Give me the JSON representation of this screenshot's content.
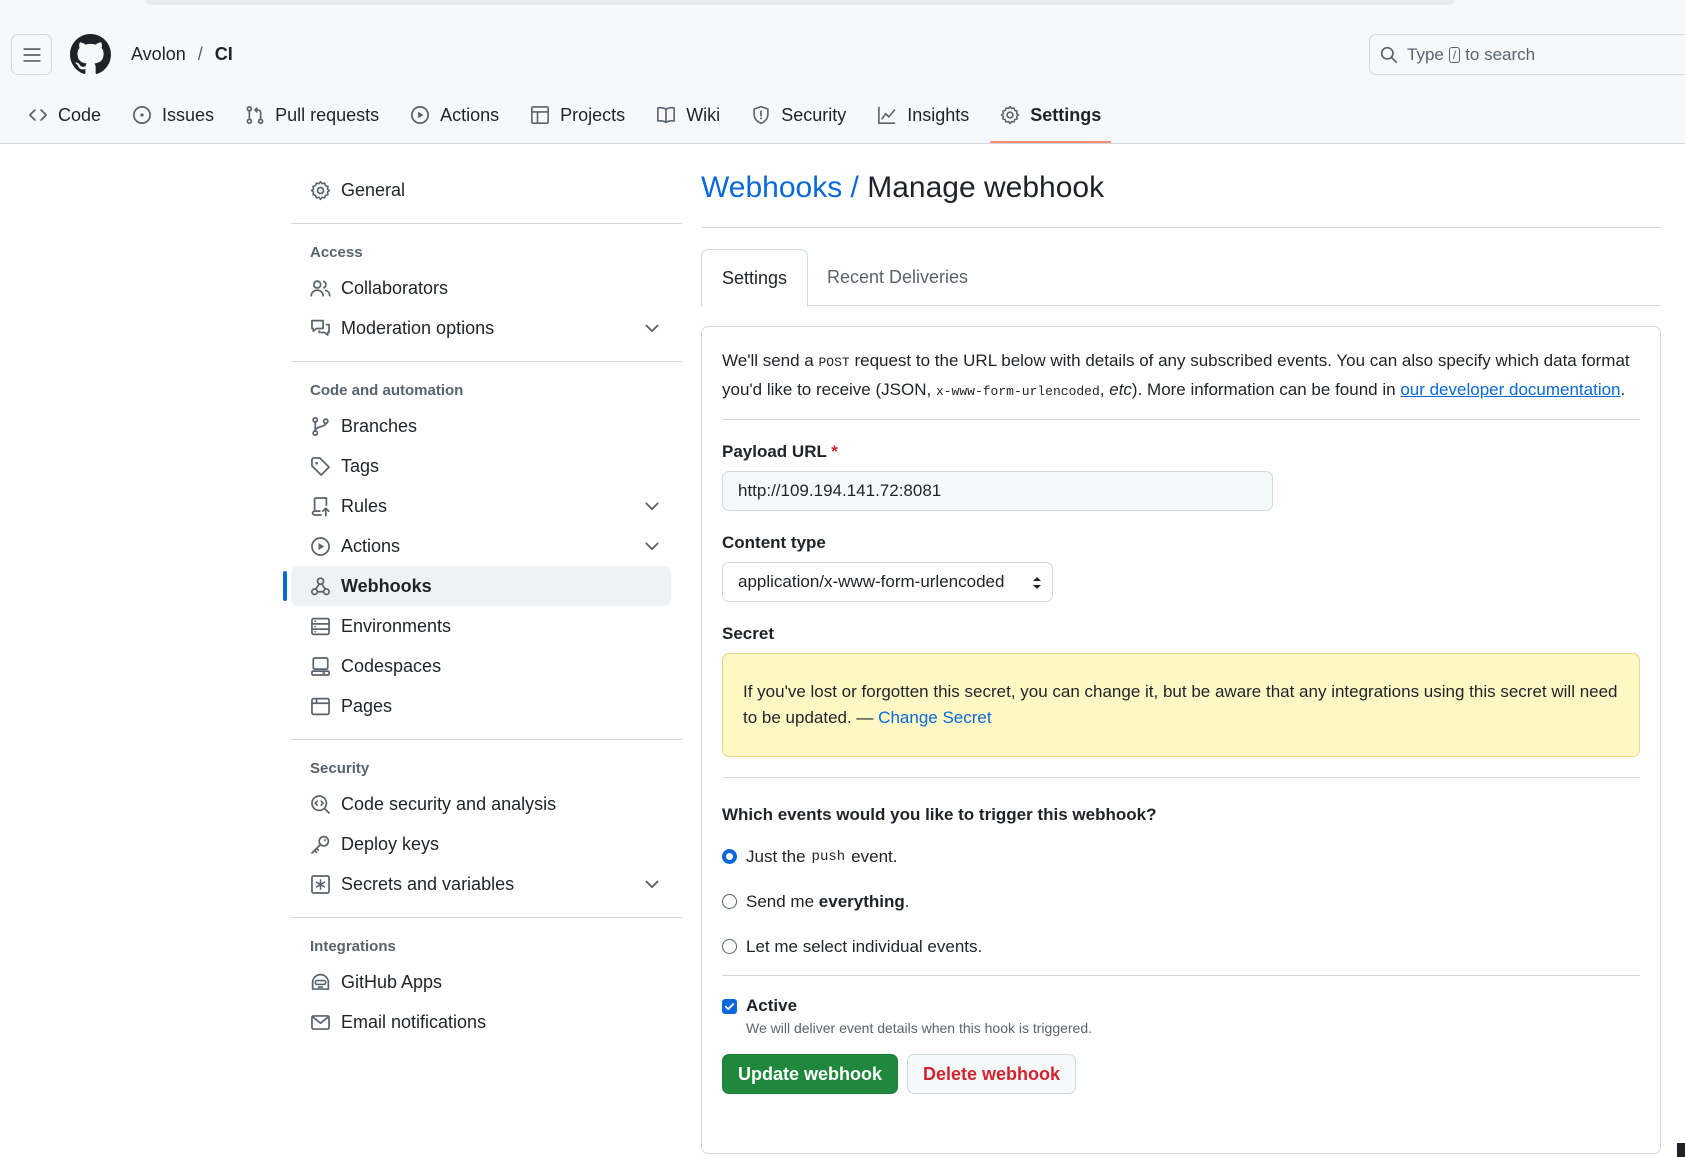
{
  "header": {
    "owner": "Avolon",
    "separator": "/",
    "repo": "CI",
    "search_before": "Type",
    "search_key": "/",
    "search_after": "to search"
  },
  "repo_tabs": [
    {
      "label": "Code",
      "icon": "code-icon"
    },
    {
      "label": "Issues",
      "icon": "issue-opened-icon"
    },
    {
      "label": "Pull requests",
      "icon": "git-pull-request-icon"
    },
    {
      "label": "Actions",
      "icon": "play-icon"
    },
    {
      "label": "Projects",
      "icon": "table-icon"
    },
    {
      "label": "Wiki",
      "icon": "book-icon"
    },
    {
      "label": "Security",
      "icon": "shield-icon"
    },
    {
      "label": "Insights",
      "icon": "graph-icon"
    },
    {
      "label": "Settings",
      "icon": "gear-icon",
      "selected": true
    }
  ],
  "sidebar": {
    "general": "General",
    "access_heading": "Access",
    "collaborators": "Collaborators",
    "moderation": "Moderation options",
    "code_heading": "Code and automation",
    "branches": "Branches",
    "tags": "Tags",
    "rules": "Rules",
    "actions": "Actions",
    "webhooks": "Webhooks",
    "environments": "Environments",
    "codespaces": "Codespaces",
    "pages": "Pages",
    "security_heading": "Security",
    "code_security": "Code security and analysis",
    "deploy_keys": "Deploy keys",
    "secrets": "Secrets and variables",
    "integrations_heading": "Integrations",
    "github_apps": "GitHub Apps",
    "email_notifications": "Email notifications"
  },
  "main": {
    "title_link": "Webhooks",
    "title_sep": "/",
    "title_rest": "Manage webhook",
    "tab_settings": "Settings",
    "tab_deliveries": "Recent Deliveries",
    "intro_1": "We'll send a",
    "intro_post": "POST",
    "intro_2": "request to the URL below with details of any subscribed events. You can also specify which data format you'd like to receive (JSON,",
    "intro_form": "x-www-form-urlencoded",
    "intro_etc": "etc",
    "intro_3": "). More information can be found in",
    "intro_link": "our developer documentation",
    "intro_end": ".",
    "payload_label": "Payload URL",
    "required_mark": "*",
    "payload_value": "http://109.194.141.72:8081",
    "content_label": "Content type",
    "content_value": "application/x-www-form-urlencoded",
    "secret_label": "Secret",
    "secret_notice": "If you've lost or forgotten this secret, you can change it, but be aware that any integrations using this secret will need to be updated. —",
    "change_secret": "Change Secret",
    "events_question": "Which events would you like to trigger this webhook?",
    "radio1_pre": "Just the",
    "radio1_code": "push",
    "radio1_post": "event.",
    "radio2_pre": "Send me",
    "radio2_bold": "everything",
    "radio2_post": ".",
    "radio3": "Let me select individual events.",
    "active_label": "Active",
    "active_hint": "We will deliver event details when this hook is triggered.",
    "update_button": "Update webhook",
    "delete_button": "Delete webhook"
  },
  "colors": {
    "accent": "#0969da",
    "tab_underline": "#fd8c73",
    "primary_button": "#1f883d",
    "danger": "#d1242f",
    "flash_bg": "#fff8c5"
  }
}
